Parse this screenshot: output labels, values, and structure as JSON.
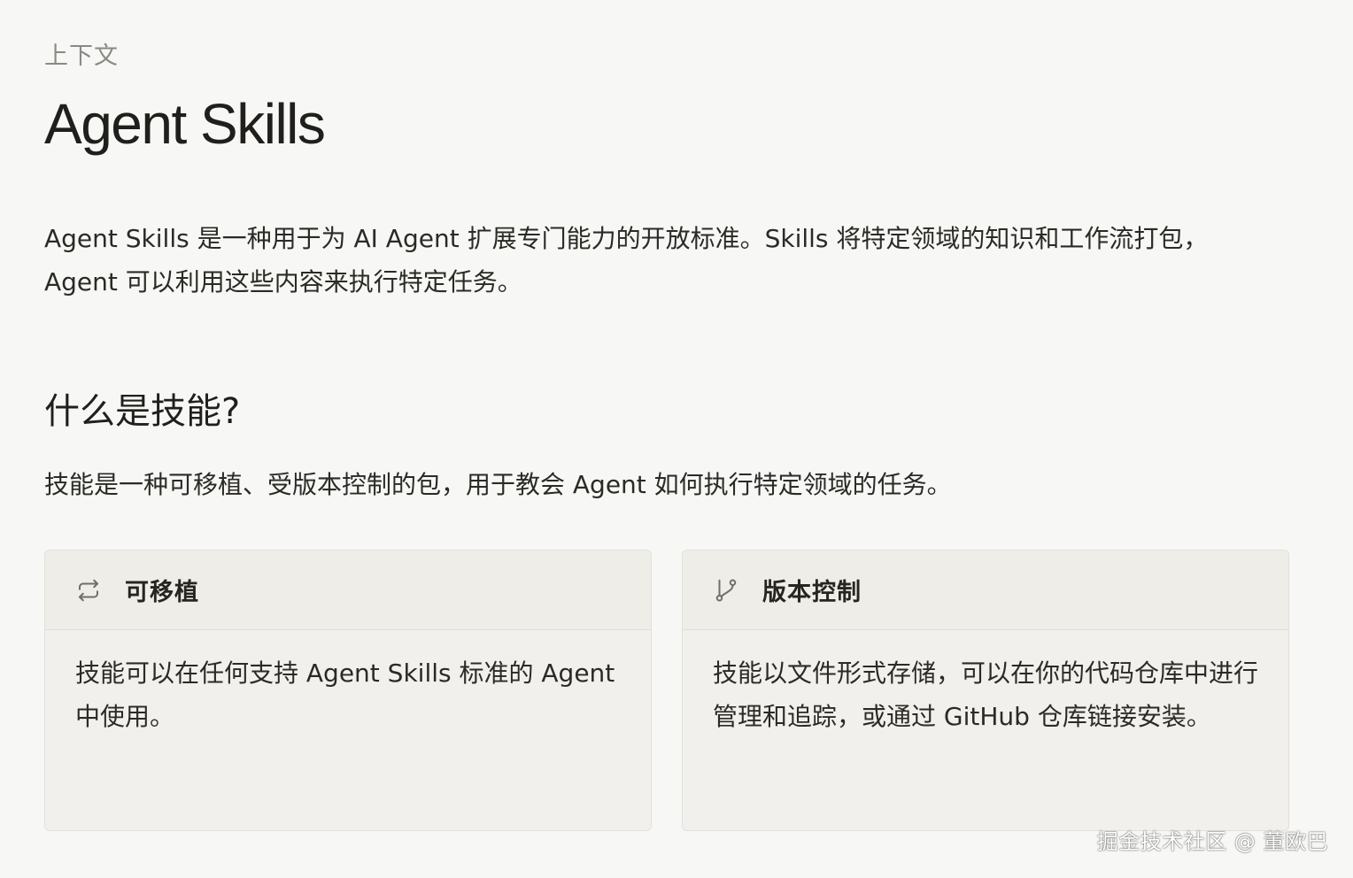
{
  "breadcrumb": "上下文",
  "title": "Agent Skills",
  "intro": "Agent Skills 是一种用于为 AI Agent 扩展专门能力的开放标准。Skills 将特定领域的知识和工作流打包，Agent 可以利用这些内容来执行特定任务。",
  "section": {
    "heading": "什么是技能?",
    "description": "技能是一种可移植、受版本控制的包，用于教会 Agent 如何执行特定领域的任务。"
  },
  "cards": [
    {
      "icon": "repeat-arrows-icon",
      "title": "可移植",
      "body": "技能可以在任何支持 Agent Skills 标准的 Agent 中使用。"
    },
    {
      "icon": "git-branch-icon",
      "title": "版本控制",
      "body": "技能以文件形式存储，可以在你的代码仓库中进行管理和追踪，或通过 GitHub 仓库链接安装。"
    }
  ],
  "watermark": "掘金技术社区 @ 董欧巴",
  "colors": {
    "background": "#f7f7f5",
    "card_background": "#f0efeb",
    "card_border": "#e2e0da",
    "text": "#26251f",
    "muted_text": "#8a8983"
  }
}
